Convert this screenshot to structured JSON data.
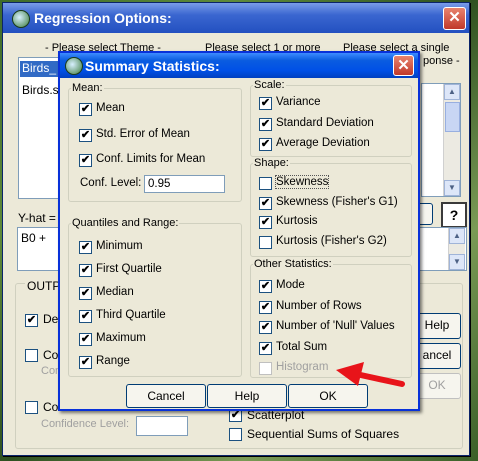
{
  "regression_window": {
    "title": "Regression Options:",
    "select_theme_label": "- Please select Theme -",
    "select_one_or_more_label": "Please select 1 or more",
    "select_single_label": "Please select a single",
    "response_label": "ponse -",
    "theme_items": [
      "Birds_",
      "Birds.s"
    ],
    "yhat_label": "Y-hat =",
    "yhat_value": "B0 +",
    "output_label": "OUTPU",
    "desc_label": "Des",
    "con_label_1": "Cor",
    "con_sub_label": "Conf",
    "con_label_2": "Cor",
    "confidence_level_label": "Confidence Level:",
    "confidence_level_value": "",
    "help_button": "Help",
    "cancel_button": "ancel",
    "ok_button": "OK",
    "scatterplot_label": "Scatterplot",
    "sequential_ss_label": "Sequential Sums of Squares",
    "help_icon": "?"
  },
  "summary_dialog": {
    "title": "Summary Statistics:",
    "mean": {
      "title": "Mean:",
      "items": [
        {
          "label": "Mean",
          "checked": true
        },
        {
          "label": "Std. Error of Mean",
          "checked": true
        },
        {
          "label": "Conf. Limits for Mean",
          "checked": true
        }
      ],
      "conf_level_label": "Conf. Level:",
      "conf_level_value": "0.95"
    },
    "quantiles": {
      "title": "Quantiles and Range:",
      "items": [
        {
          "label": "Minimum",
          "checked": true
        },
        {
          "label": "First Quartile",
          "checked": true
        },
        {
          "label": "Median",
          "checked": true
        },
        {
          "label": "Third Quartile",
          "checked": true
        },
        {
          "label": "Maximum",
          "checked": true
        },
        {
          "label": "Range",
          "checked": true
        }
      ]
    },
    "scale": {
      "title": "Scale:",
      "items": [
        {
          "label": "Variance",
          "checked": true
        },
        {
          "label": "Standard Deviation",
          "checked": true
        },
        {
          "label": "Average Deviation",
          "checked": true
        }
      ]
    },
    "shape": {
      "title": "Shape:",
      "items": [
        {
          "label": "Skewness",
          "checked": false
        },
        {
          "label": "Skewness (Fisher's G1)",
          "checked": true
        },
        {
          "label": "Kurtosis",
          "checked": true
        },
        {
          "label": "Kurtosis (Fisher's G2)",
          "checked": false
        }
      ]
    },
    "other": {
      "title": "Other Statistics:",
      "items": [
        {
          "label": "Mode",
          "checked": true
        },
        {
          "label": "Number of Rows",
          "checked": true
        },
        {
          "label": "Number of 'Null' Values",
          "checked": true
        },
        {
          "label": "Total Sum",
          "checked": true
        },
        {
          "label": "Histogram",
          "checked": false,
          "disabled": true
        }
      ]
    },
    "buttons": {
      "cancel": "Cancel",
      "help": "Help",
      "ok": "OK"
    }
  },
  "icons": {
    "checkmark": "✔",
    "close": "✕",
    "arrow_up": "▲",
    "arrow_down": "▼"
  },
  "colors": {
    "title_blue": "#0050e6",
    "dialog_bg": "#ece9d8",
    "annotation_arrow": "#e8141a"
  }
}
